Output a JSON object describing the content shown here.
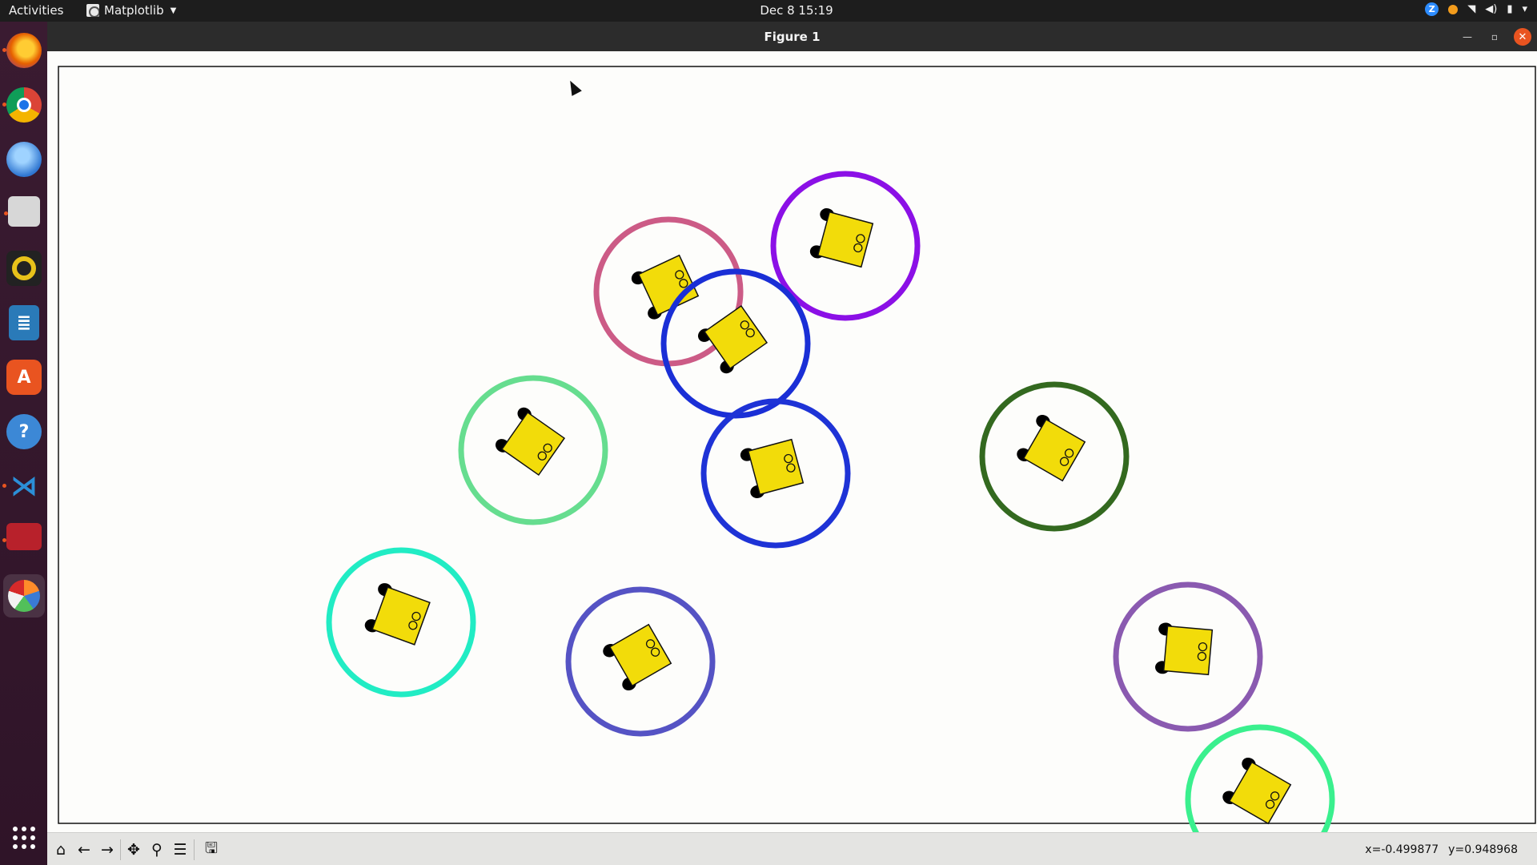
{
  "topbar": {
    "activities": "Activities",
    "app_name": "Matplotlib",
    "clock": "Dec 8  15:19"
  },
  "dock": {
    "items": [
      {
        "name": "firefox",
        "icon": "firefox-icon",
        "color": "#e66000"
      },
      {
        "name": "chrome",
        "icon": "chrome-icon",
        "color": "#1a73e8"
      },
      {
        "name": "thunderbird",
        "icon": "thunderbird-icon",
        "color": "#2f76d1"
      },
      {
        "name": "files",
        "icon": "files-icon",
        "color": "#cfcfcf"
      },
      {
        "name": "rhythmbox",
        "icon": "rhythmbox-icon",
        "color": "#e8c21a"
      },
      {
        "name": "writer",
        "icon": "writer-icon",
        "color": "#2a7ab8"
      },
      {
        "name": "software",
        "icon": "software-center-icon",
        "color": "#e95420"
      },
      {
        "name": "help",
        "icon": "help-icon",
        "color": "#3c88d6"
      },
      {
        "name": "vscode",
        "icon": "vscode-icon",
        "color": "#2b8fd8"
      },
      {
        "name": "terminal-app",
        "icon": "media-app-icon",
        "color": "#b8212b"
      },
      {
        "name": "matplotlib",
        "icon": "matplotlib-icon",
        "color": "#f2f2f2"
      }
    ]
  },
  "window": {
    "title": "Figure 1"
  },
  "toolbar": {
    "buttons": [
      "home-icon",
      "back-icon",
      "forward-icon",
      "pan-icon",
      "zoom-icon",
      "configure-icon",
      "save-icon"
    ]
  },
  "status": {
    "x_readout": "x=-0.499877",
    "y_readout": "y=0.948968"
  },
  "plot": {
    "robots": [
      {
        "ring_color": "#cc5b86",
        "rotation": -25
      },
      {
        "ring_color": "#8b10e6",
        "rotation": 15
      },
      {
        "ring_color": "#1a2fd6",
        "rotation": -35
      },
      {
        "ring_color": "#66dd8f",
        "rotation": 35
      },
      {
        "ring_color": "#1e33d6",
        "rotation": -15
      },
      {
        "ring_color": "#33691f",
        "rotation": 30
      },
      {
        "ring_color": "#21ecc4",
        "rotation": 20
      },
      {
        "ring_color": "#5553c4",
        "rotation": -30
      },
      {
        "ring_color": "#8a5ab0",
        "rotation": 5
      },
      {
        "ring_color": "#3af08e",
        "rotation": 30
      }
    ]
  }
}
